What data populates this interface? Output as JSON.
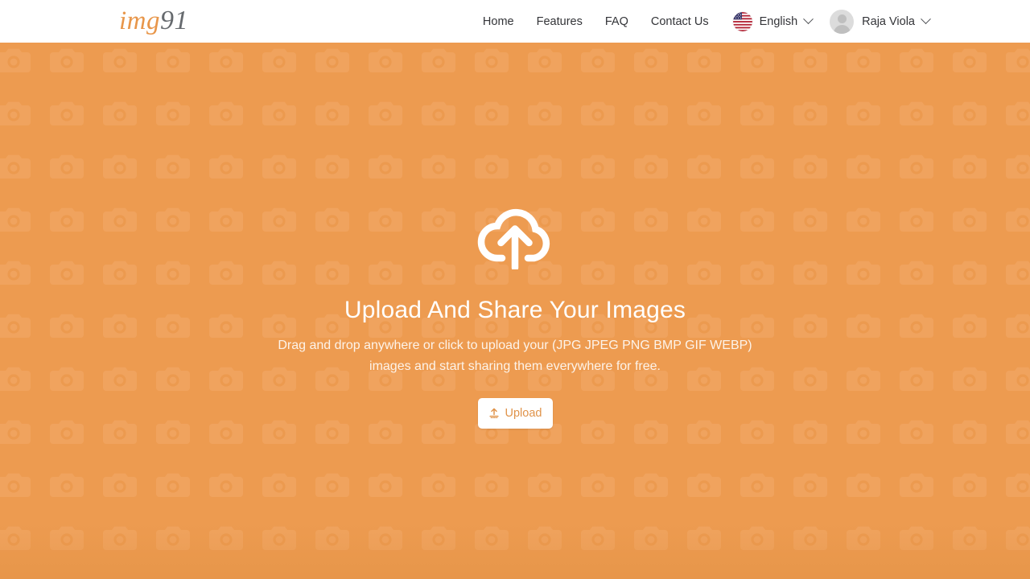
{
  "header": {
    "logo": {
      "part1": "img",
      "part2": "91"
    },
    "nav_links": [
      {
        "label": "Home",
        "name": "nav-link-home"
      },
      {
        "label": "Features",
        "name": "nav-link-features"
      },
      {
        "label": "FAQ",
        "name": "nav-link-faq"
      },
      {
        "label": "Contact Us",
        "name": "nav-link-contact-us"
      }
    ],
    "language": {
      "label": "English",
      "flag_icon": "us-flag-icon",
      "chevron_icon": "chevron-down-icon"
    },
    "user": {
      "name": "Raja Viola",
      "avatar_icon": "user-avatar-placeholder-icon",
      "chevron_icon": "chevron-down-icon"
    }
  },
  "hero": {
    "cloud_icon": "cloud-upload-icon",
    "title": "Upload And Share Your Images",
    "subtitle_line1": "Drag and drop anywhere or click to upload your (JPG JPEG PNG BMP GIF WEBP)",
    "subtitle_line2": "images and start sharing them everywhere for free.",
    "upload_button": {
      "label": "Upload",
      "icon": "upload-arrow-icon"
    },
    "background_icon": "camera-icon-tile"
  },
  "colors": {
    "brand_orange": "#ED9B50",
    "logo_orange": "#E8964A",
    "logo_gray": "#666A6E",
    "header_bg": "#FFFFFF",
    "text_dark": "#333438",
    "hero_text": "#FFFFFF",
    "button_bg": "#FFFFFF",
    "button_text": "#E0934A",
    "pattern_tile": "#F0A35E"
  }
}
